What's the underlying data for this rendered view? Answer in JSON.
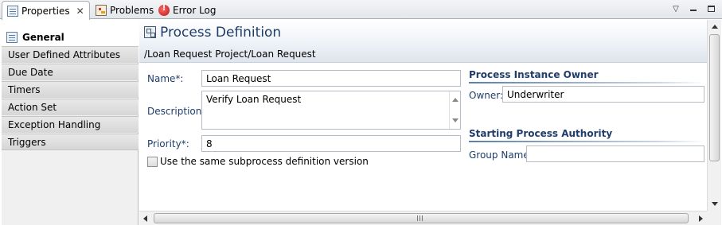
{
  "tabs": [
    {
      "label": "Properties",
      "active": true,
      "icon": "properties-icon",
      "closable": true
    },
    {
      "label": "Problems",
      "active": false,
      "icon": "problems-icon"
    },
    {
      "label": "Error Log",
      "active": false,
      "icon": "error-log-icon"
    }
  ],
  "window_controls": {
    "menu": "▽",
    "minimize": "minimize-icon",
    "maximize": "maximize-icon"
  },
  "sidebar": {
    "selected": "General",
    "items": [
      "User Defined Attributes",
      "Due Date",
      "Timers",
      "Action Set",
      "Exception Handling",
      "Triggers"
    ]
  },
  "header": {
    "title": "Process Definition",
    "path": "/Loan Request Project/Loan Request"
  },
  "form": {
    "name_label": "Name*:",
    "name_value": "Loan Request",
    "description_label": "Description:",
    "description_value": "Verify Loan Request",
    "priority_label": "Priority*:",
    "priority_value": "8",
    "checkbox_label": "Use the same subprocess definition version",
    "checkbox_checked": false
  },
  "owner_section": {
    "title": "Process Instance Owner",
    "owner_label": "Owner:",
    "owner_value": "Underwriter"
  },
  "authority_section": {
    "title": "Starting Process Authority",
    "group_label": "Group Name",
    "group_value": ""
  },
  "colors": {
    "label_text": "#1f3d6b",
    "section_rule": "#5c7fa6",
    "sidebar_bg": "#f0f0f0"
  }
}
